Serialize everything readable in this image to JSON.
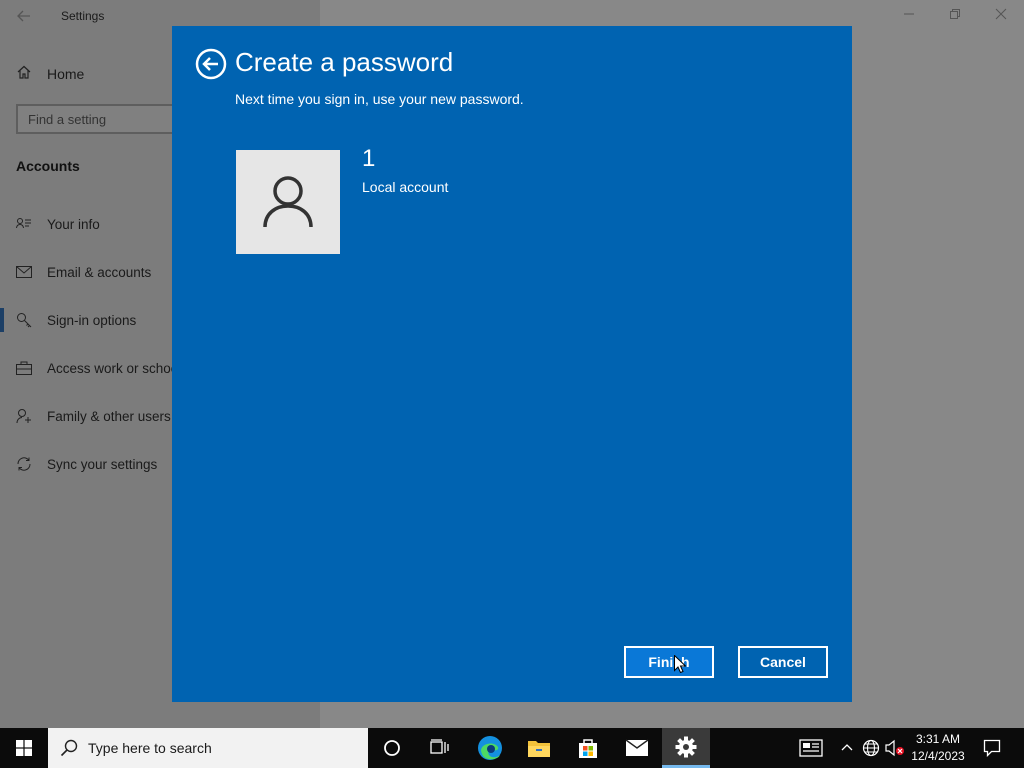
{
  "settings": {
    "title": "Settings",
    "home_label": "Home",
    "search_placeholder": "Find a setting",
    "section_heading": "Accounts",
    "nav": [
      {
        "label": "Your info",
        "icon": "contact-card-icon"
      },
      {
        "label": "Email & accounts",
        "icon": "mail-icon"
      },
      {
        "label": "Sign-in options",
        "icon": "key-icon",
        "selected": true
      },
      {
        "label": "Access work or school",
        "icon": "briefcase-icon"
      },
      {
        "label": "Family & other users",
        "icon": "person-add-icon"
      },
      {
        "label": "Sync your settings",
        "icon": "sync-icon"
      }
    ]
  },
  "dialog": {
    "title": "Create a password",
    "subtitle": "Next time you sign in, use your new password.",
    "account_name": "1",
    "account_type": "Local account",
    "finish_label": "Finish",
    "cancel_label": "Cancel",
    "background_color": "#0063b1"
  },
  "taskbar": {
    "search_placeholder": "Type here to search",
    "time": "3:31 AM",
    "date": "12/4/2023",
    "pinned": [
      "cortana-icon",
      "task-view-icon",
      "edge-icon",
      "file-explorer-icon",
      "store-icon",
      "mail-icon",
      "settings-icon"
    ],
    "active_app": "settings-icon",
    "accent_color": "#76b9ed"
  }
}
